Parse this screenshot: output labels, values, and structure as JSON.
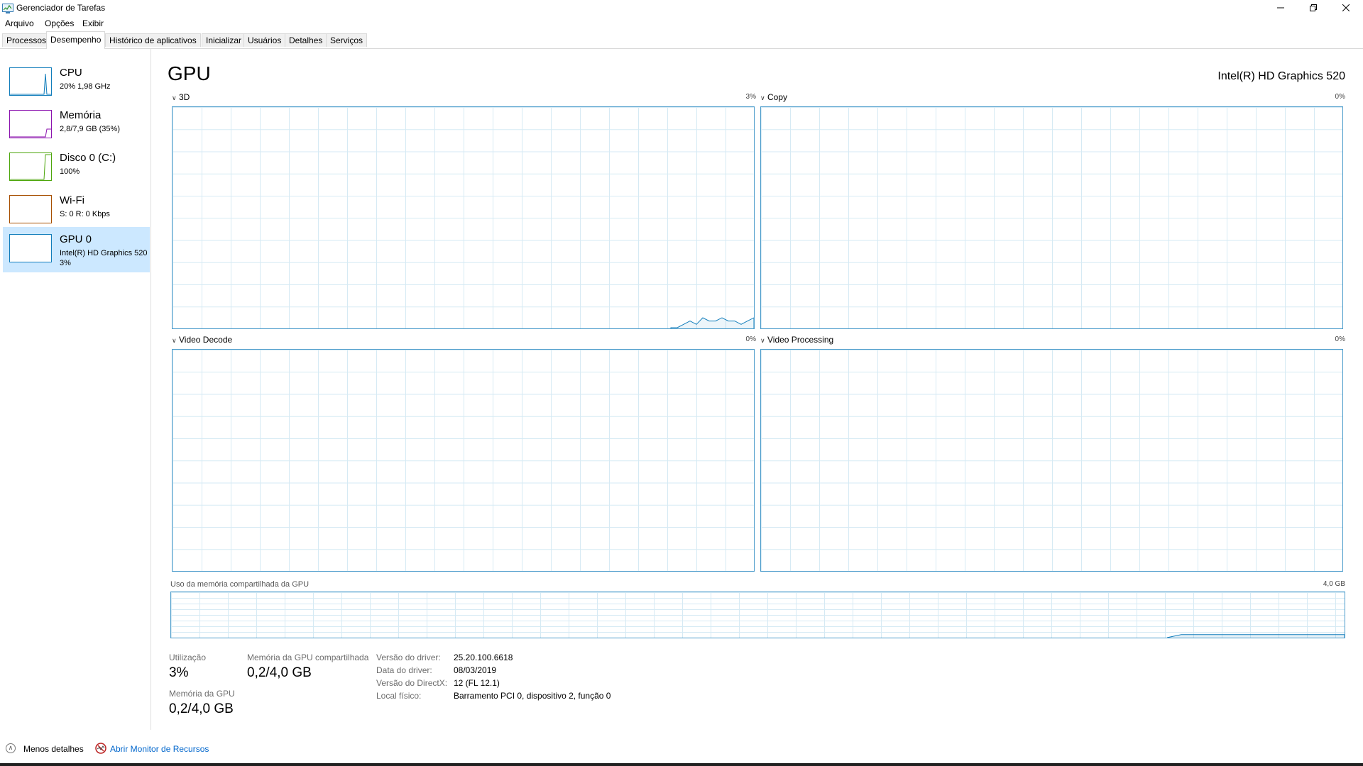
{
  "window": {
    "title": "Gerenciador de Tarefas",
    "minimize_icon": "minimize-icon",
    "restore_icon": "restore-icon",
    "close_icon": "close-icon"
  },
  "menu": [
    "Arquivo",
    "Opções",
    "Exibir"
  ],
  "tabs": [
    {
      "label": "Processos",
      "active": false
    },
    {
      "label": "Desempenho",
      "active": true
    },
    {
      "label": "Histórico de aplicativos",
      "active": false
    },
    {
      "label": "Inicializar",
      "active": false
    },
    {
      "label": "Usuários",
      "active": false
    },
    {
      "label": "Detalhes",
      "active": false
    },
    {
      "label": "Serviços",
      "active": false
    }
  ],
  "sidebar": {
    "items": [
      {
        "name": "CPU",
        "sub": "20%  1,98 GHz",
        "sub2": "",
        "color": "#117dbb",
        "selected": false
      },
      {
        "name": "Memória",
        "sub": "2,8/7,9 GB (35%)",
        "sub2": "",
        "color": "#8b12ae",
        "selected": false
      },
      {
        "name": "Disco 0 (C:)",
        "sub": "100%",
        "sub2": "",
        "color": "#4da60c",
        "selected": false
      },
      {
        "name": "Wi-Fi",
        "sub": "S: 0 R: 0 Kbps",
        "sub2": "",
        "color": "#a74f01",
        "selected": false
      },
      {
        "name": "GPU 0",
        "sub": "Intel(R) HD Graphics 520",
        "sub2": "3%",
        "color": "#117dbb",
        "selected": true
      }
    ]
  },
  "main": {
    "title": "GPU",
    "device": "Intel(R) HD Graphics 520",
    "graphs": [
      {
        "label": "3D",
        "percent": "3%"
      },
      {
        "label": "Copy",
        "percent": "0%"
      },
      {
        "label": "Video Decode",
        "percent": "0%"
      },
      {
        "label": "Video Processing",
        "percent": "0%"
      }
    ],
    "graph_3d_recent_usage_percent": [
      0,
      0,
      1,
      2,
      1,
      3,
      2,
      2,
      3,
      2,
      2,
      1,
      2,
      3
    ],
    "shared_memory": {
      "label": "Uso da memória compartilhada da GPU",
      "max": "4,0 GB",
      "fraction": 0.05
    },
    "stats": {
      "utilization_label": "Utilização",
      "utilization_value": "3%",
      "shared_mem_label": "Memória da GPU compartilhada",
      "shared_mem_value": "0,2/4,0 GB",
      "gpu_mem_label": "Memória da GPU",
      "gpu_mem_value": "0,2/4,0 GB"
    },
    "info": [
      {
        "key": "Versão do driver:",
        "value": "25.20.100.6618"
      },
      {
        "key": "Data do driver:",
        "value": "08/03/2019"
      },
      {
        "key": "Versão do DirectX:",
        "value": "12 (FL 12.1)"
      },
      {
        "key": "Local físico:",
        "value": "Barramento PCI 0, dispositivo 2, função 0"
      }
    ]
  },
  "footer": {
    "less_details": "Menos detalhes",
    "resource_monitor": "Abrir Monitor de Recursos"
  },
  "colors": {
    "graph_border": "#4a9bcb",
    "grid": "#d6eaf4",
    "selected_bg": "#cce8ff",
    "link": "#0066cc"
  }
}
